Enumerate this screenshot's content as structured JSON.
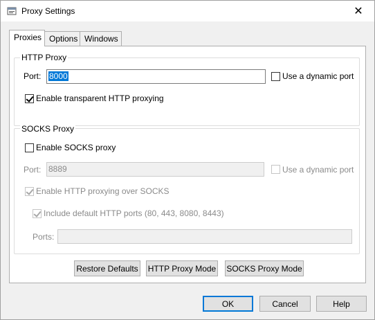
{
  "window": {
    "title": "Proxy Settings",
    "close_glyph": "✕",
    "icon": "proxy-app-icon"
  },
  "tabs": [
    {
      "label": "Proxies",
      "active": true
    },
    {
      "label": "Options",
      "active": false
    },
    {
      "label": "Windows",
      "active": false
    }
  ],
  "http_proxy": {
    "group_label": "HTTP Proxy",
    "port_label": "Port:",
    "port_value": "8000",
    "dynamic_port_label": "Use a dynamic port",
    "dynamic_port_checked": false,
    "transparent_label": "Enable transparent HTTP proxying",
    "transparent_checked": true
  },
  "socks_proxy": {
    "group_label": "SOCKS Proxy",
    "enable_label": "Enable SOCKS proxy",
    "enable_checked": false,
    "port_label": "Port:",
    "port_value": "8889",
    "dynamic_port_label": "Use a dynamic port",
    "http_over_socks_label": "Enable HTTP proxying over SOCKS",
    "http_over_socks_checked": true,
    "include_default_label": "Include default HTTP ports (80, 443, 8080, 8443)",
    "include_default_checked": true,
    "ports_label": "Ports:",
    "ports_value": ""
  },
  "panel_buttons": {
    "restore_defaults": "Restore Defaults",
    "http_mode": "HTTP Proxy Mode",
    "socks_mode": "SOCKS Proxy Mode"
  },
  "dialog_buttons": {
    "ok": "OK",
    "cancel": "Cancel",
    "help": "Help"
  },
  "colors": {
    "accent": "#0078d7",
    "disabled_text": "#8a8a8a"
  }
}
